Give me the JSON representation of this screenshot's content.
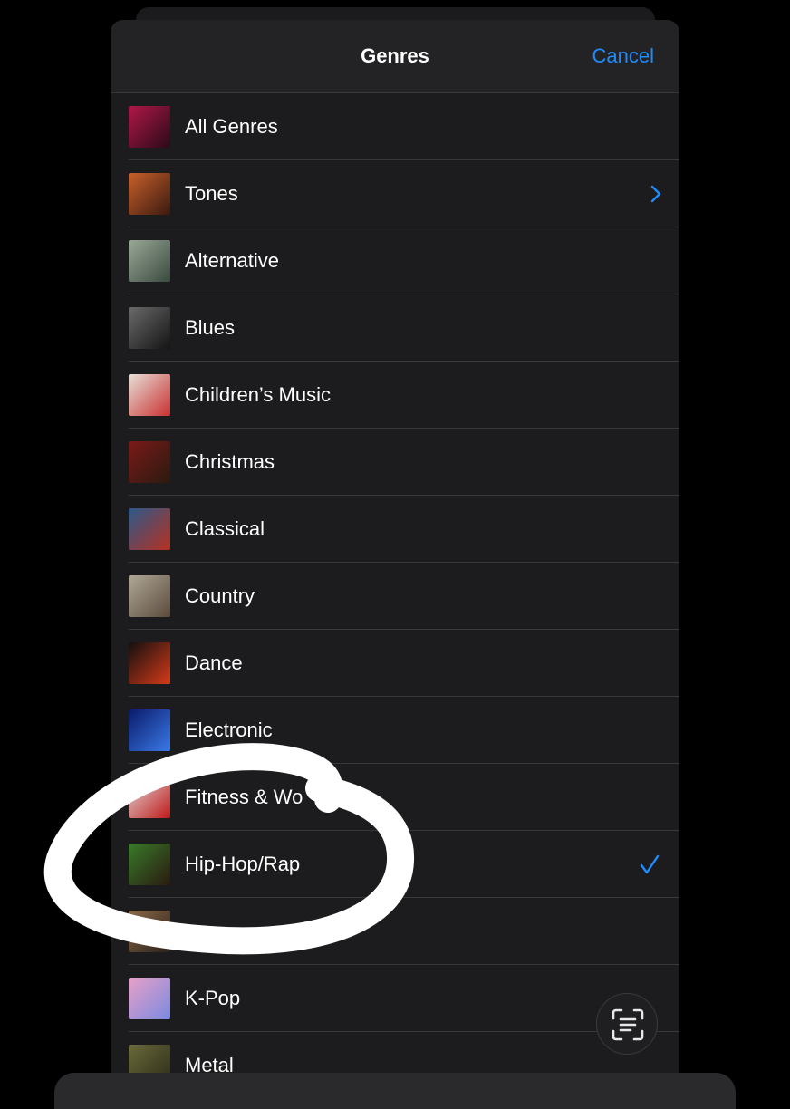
{
  "header": {
    "title": "Genres",
    "cancel_label": "Cancel"
  },
  "genres": [
    {
      "label": "All Genres",
      "art": [
        "#b01848",
        "#2a0a18"
      ],
      "accessory": "none"
    },
    {
      "label": "Tones",
      "art": [
        "#c8602a",
        "#3a1a10"
      ],
      "accessory": "chevron"
    },
    {
      "label": "Alternative",
      "art": [
        "#9aa898",
        "#3a4a3e"
      ],
      "accessory": "none"
    },
    {
      "label": "Blues",
      "art": [
        "#6a6a6a",
        "#141414"
      ],
      "accessory": "none"
    },
    {
      "label": "Children’s Music",
      "art": [
        "#e8e0d8",
        "#c83030"
      ],
      "accessory": "none"
    },
    {
      "label": "Christmas",
      "art": [
        "#7a1a18",
        "#2a1a10"
      ],
      "accessory": "none"
    },
    {
      "label": "Classical",
      "art": [
        "#2a5a8a",
        "#b83020"
      ],
      "accessory": "none"
    },
    {
      "label": "Country",
      "art": [
        "#b0a898",
        "#5a4a3a"
      ],
      "accessory": "none"
    },
    {
      "label": "Dance",
      "art": [
        "#101010",
        "#d83a18"
      ],
      "accessory": "none"
    },
    {
      "label": "Electronic",
      "art": [
        "#0a1a6a",
        "#3a7ae8"
      ],
      "accessory": "none"
    },
    {
      "label": "Fitness & Wo",
      "art": [
        "#e0e0e0",
        "#c01818"
      ],
      "accessory": "none"
    },
    {
      "label": "Hip-Hop/Rap",
      "art": [
        "#3a7a2a",
        "#2a1a10"
      ],
      "accessory": "check"
    },
    {
      "label": "",
      "art": [
        "#8a6a4a",
        "#2a2018"
      ],
      "accessory": "none"
    },
    {
      "label": "K-Pop",
      "art": [
        "#e8a0c8",
        "#7a8ae0"
      ],
      "accessory": "none"
    },
    {
      "label": "Metal",
      "art": [
        "#6a6a3a",
        "#2a2a18"
      ],
      "accessory": "none"
    }
  ],
  "icons": {
    "chevron": "chevron-right-icon",
    "check": "checkmark-icon",
    "scan": "live-text-scan-icon"
  },
  "colors": {
    "accent": "#1e8bff",
    "background": "#1c1c1e",
    "annotation": "#ffffff"
  }
}
